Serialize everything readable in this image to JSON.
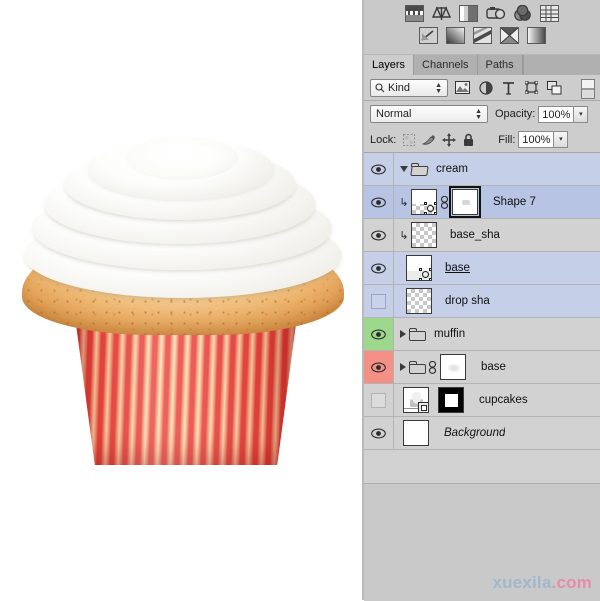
{
  "app": {
    "name": "Adobe Photoshop",
    "watermark_primary": "xuexila",
    "watermark_secondary": ".com"
  },
  "canvas": {
    "artwork_name": "cupcake",
    "description": "Vanilla cupcake with white swirled frosting and red-and-cream striped paper wrapper",
    "background_color": "#ffffff",
    "frosting_color": "#fdfdfc",
    "muffin_color": "#eeb873",
    "wrapper_color": "#e8453f"
  },
  "adjustments_panel": {
    "row1": [
      {
        "name": "brightness-contrast-icon",
        "title": "Brightness/Contrast"
      },
      {
        "name": "levels-icon",
        "title": "Levels"
      },
      {
        "name": "curves-icon",
        "title": "Curves"
      },
      {
        "name": "exposure-icon",
        "title": "Exposure"
      },
      {
        "name": "vibrance-icon",
        "title": "Vibrance"
      },
      {
        "name": "hue-saturation-icon",
        "title": "Hue/Saturation"
      }
    ],
    "row2": [
      {
        "name": "color-balance-icon",
        "title": "Color Balance"
      },
      {
        "name": "black-white-icon",
        "title": "Black & White"
      },
      {
        "name": "photo-filter-icon",
        "title": "Photo Filter"
      },
      {
        "name": "channel-mixer-icon",
        "title": "Channel Mixer"
      },
      {
        "name": "gradient-map-icon",
        "title": "Gradient Map"
      }
    ]
  },
  "tabs": [
    {
      "label": "Layers",
      "active": true
    },
    {
      "label": "Channels",
      "active": false
    },
    {
      "label": "Paths",
      "active": false
    }
  ],
  "filter_bar": {
    "kind_label": "Kind",
    "search_icon": "magnifier-icon",
    "filter_icons": [
      {
        "name": "filter-pixel-layers-icon",
        "title": "Filter for pixel layers"
      },
      {
        "name": "filter-adjustment-layers-icon",
        "title": "Filter for adjustment layers"
      },
      {
        "name": "filter-type-layers-icon",
        "title": "Filter for type layers"
      },
      {
        "name": "filter-shape-layers-icon",
        "title": "Filter for shape layers"
      },
      {
        "name": "filter-smart-object-icon",
        "title": "Filter for smart objects"
      }
    ],
    "toggle_name": "filter-enable-toggle"
  },
  "blend_bar": {
    "mode": "Normal",
    "opacity_label": "Opacity:",
    "opacity_value": "100%"
  },
  "lock_bar": {
    "lock_label": "Lock:",
    "lock_icons": [
      {
        "name": "lock-transparent-pixels-icon",
        "title": "Lock transparent pixels"
      },
      {
        "name": "lock-image-pixels-icon",
        "title": "Lock image pixels"
      },
      {
        "name": "lock-position-icon",
        "title": "Lock position"
      },
      {
        "name": "lock-all-icon",
        "title": "Lock all"
      }
    ],
    "fill_label": "Fill:",
    "fill_value": "100%"
  },
  "layers": [
    {
      "name": "cream",
      "type": "group",
      "visible": true,
      "expanded": true,
      "indent": 0,
      "selected": "light",
      "clipped": false,
      "linked": false,
      "color_label": "none",
      "thumb": "folder-open",
      "name_style": "normal"
    },
    {
      "name": "Shape 7",
      "type": "shape",
      "visible": true,
      "expanded": false,
      "indent": 1,
      "selected": "full",
      "clipped": true,
      "linked": true,
      "color_label": "none",
      "thumb": "shape-with-vector-mask",
      "mask_selected": true,
      "name_style": "normal"
    },
    {
      "name": "base_sha",
      "type": "pixel",
      "visible": true,
      "expanded": false,
      "indent": 1,
      "selected": "none",
      "clipped": true,
      "linked": false,
      "color_label": "none",
      "thumb": "transparent",
      "name_style": "normal"
    },
    {
      "name": "base",
      "type": "shape",
      "visible": true,
      "expanded": false,
      "indent": 0,
      "selected": "light",
      "clipped": false,
      "linked": false,
      "color_label": "none",
      "thumb": "shape-white",
      "name_style": "underline"
    },
    {
      "name": "drop sha",
      "type": "pixel",
      "visible": false,
      "expanded": false,
      "indent": 0,
      "selected": "light",
      "clipped": false,
      "linked": false,
      "color_label": "none",
      "thumb": "transparent",
      "name_style": "normal"
    },
    {
      "name": "muffin",
      "type": "group",
      "visible": true,
      "expanded": false,
      "indent": 0,
      "selected": "none",
      "clipped": false,
      "linked": false,
      "color_label": "green",
      "thumb": "folder-closed",
      "name_style": "normal"
    },
    {
      "name": "base",
      "type": "group",
      "visible": true,
      "expanded": false,
      "indent": 0,
      "selected": "none",
      "clipped": false,
      "linked": true,
      "color_label": "red",
      "thumb": "folder-closed-with-mask",
      "name_style": "normal"
    },
    {
      "name": "cupcakes",
      "type": "smart-object",
      "visible": false,
      "expanded": false,
      "indent": 0,
      "selected": "none",
      "clipped": false,
      "linked": false,
      "color_label": "none",
      "thumb": "smart-object-with-black-mask",
      "name_style": "normal"
    },
    {
      "name": "Background",
      "type": "background",
      "visible": true,
      "expanded": false,
      "indent": 0,
      "selected": "none",
      "clipped": false,
      "linked": false,
      "color_label": "none",
      "thumb": "white",
      "name_style": "italic"
    }
  ],
  "colors": {
    "panel_bg": "#c9c9c9",
    "list_bg": "#d2d2d2",
    "selection_blue": "#b8c4e4",
    "selection_blue_light": "#c5cfe8",
    "label_green": "#9ed88d",
    "label_red": "#f49086",
    "watermark_blue": "#9fb7cc",
    "watermark_pink": "#e88aa8"
  }
}
